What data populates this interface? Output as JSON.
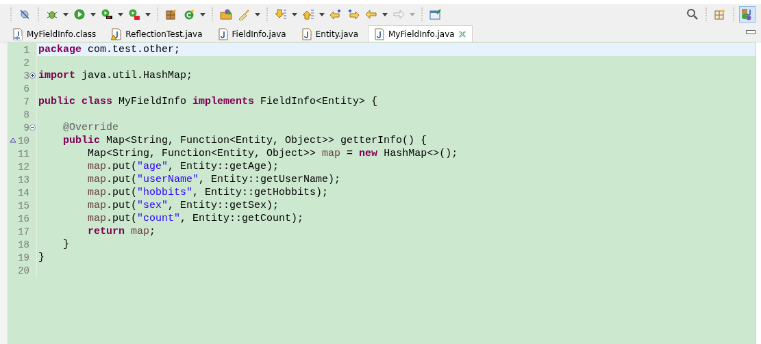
{
  "toolbar": {
    "items": [
      {
        "kind": "separator"
      },
      {
        "kind": "skip"
      },
      {
        "kind": "separator"
      },
      {
        "kind": "debug",
        "dropdown": true
      },
      {
        "kind": "run",
        "dropdown": true
      },
      {
        "kind": "coverage",
        "dropdown": true
      },
      {
        "kind": "external",
        "dropdown": true
      },
      {
        "kind": "separator"
      },
      {
        "kind": "new-package"
      },
      {
        "kind": "new-class",
        "dropdown": true
      },
      {
        "kind": "separator"
      },
      {
        "kind": "open-type"
      },
      {
        "kind": "open-task",
        "dropdown": true
      },
      {
        "kind": "separator"
      },
      {
        "kind": "next",
        "dropdown": true
      },
      {
        "kind": "prev",
        "dropdown": true
      },
      {
        "kind": "edit-back"
      },
      {
        "kind": "edit-forward"
      },
      {
        "kind": "back",
        "dropdown": true
      },
      {
        "kind": "forward",
        "dropdown": true,
        "disabled": true
      },
      {
        "kind": "separator"
      },
      {
        "kind": "pin"
      }
    ],
    "right": [
      {
        "kind": "search"
      },
      {
        "kind": "separator"
      },
      {
        "kind": "open-perspective"
      },
      {
        "kind": "separator"
      },
      {
        "kind": "java-perspective",
        "selected": true
      }
    ]
  },
  "tabs": [
    {
      "label": "MyFieldInfo.class",
      "kind": "class",
      "warning": false,
      "selected": false
    },
    {
      "label": "ReflectionTest.java",
      "kind": "java",
      "warning": true,
      "selected": false
    },
    {
      "label": "FieldInfo.java",
      "kind": "java",
      "warning": false,
      "selected": false
    },
    {
      "label": "Entity.java",
      "kind": "java",
      "warning": false,
      "selected": false
    },
    {
      "label": "MyFieldInfo.java",
      "kind": "java",
      "warning": false,
      "selected": true
    }
  ],
  "editor": {
    "lines": [
      {
        "number": "1",
        "current": true,
        "tokens": [
          {
            "kind": "keyword",
            "text": "package"
          },
          {
            "kind": "plain",
            "text": " com.test.other;"
          }
        ]
      },
      {
        "number": "2",
        "current": false
      },
      {
        "number": "3",
        "current": false,
        "collapsed": true,
        "tokens": [
          {
            "kind": "keyword",
            "text": "import"
          },
          {
            "kind": "plain",
            "text": " java.util.HashMap;"
          }
        ]
      },
      {
        "number": "6",
        "current": false
      },
      {
        "number": "7",
        "current": false,
        "tokens": [
          {
            "kind": "keyword",
            "text": "public"
          },
          {
            "kind": "keyword",
            "text": " class"
          },
          {
            "kind": "plain",
            "text": " MyFieldInfo "
          },
          {
            "kind": "keyword",
            "text": "implements"
          },
          {
            "kind": "plain",
            "text": " FieldInfo<Entity> {"
          }
        ]
      },
      {
        "number": "8",
        "current": false
      },
      {
        "number": "9",
        "current": false,
        "collapsed": false,
        "tokens": [
          {
            "kind": "annotation",
            "text": "    @Override"
          }
        ]
      },
      {
        "number": "10",
        "current": false,
        "override": true,
        "tokens": [
          {
            "kind": "keyword",
            "text": "    public"
          },
          {
            "kind": "plain",
            "text": " Map<String, Function<Entity, Object>> getterInfo() {"
          }
        ]
      },
      {
        "number": "11",
        "current": false,
        "tokens": [
          {
            "kind": "plain",
            "text": "        Map<String, Function<Entity, Object>> "
          },
          {
            "kind": "variable",
            "text": "map"
          },
          {
            "kind": "plain",
            "text": " = "
          },
          {
            "kind": "keyword",
            "text": "new"
          },
          {
            "kind": "plain",
            "text": " HashMap<>();"
          }
        ]
      },
      {
        "number": "12",
        "current": false,
        "tokens": [
          {
            "kind": "variable",
            "text": "        map"
          },
          {
            "kind": "plain",
            "text": ".put("
          },
          {
            "kind": "string",
            "text": "\"age\""
          },
          {
            "kind": "plain",
            "text": ", Entity::getAge);"
          }
        ]
      },
      {
        "number": "13",
        "current": false,
        "tokens": [
          {
            "kind": "variable",
            "text": "        map"
          },
          {
            "kind": "plain",
            "text": ".put("
          },
          {
            "kind": "string",
            "text": "\"userName\""
          },
          {
            "kind": "plain",
            "text": ", Entity::getUserName);"
          }
        ]
      },
      {
        "number": "14",
        "current": false,
        "tokens": [
          {
            "kind": "variable",
            "text": "        map"
          },
          {
            "kind": "plain",
            "text": ".put("
          },
          {
            "kind": "string",
            "text": "\"hobbits\""
          },
          {
            "kind": "plain",
            "text": ", Entity::getHobbits);"
          }
        ]
      },
      {
        "number": "15",
        "current": false,
        "tokens": [
          {
            "kind": "variable",
            "text": "        map"
          },
          {
            "kind": "plain",
            "text": ".put("
          },
          {
            "kind": "string",
            "text": "\"sex\""
          },
          {
            "kind": "plain",
            "text": ", Entity::getSex);"
          }
        ]
      },
      {
        "number": "16",
        "current": false,
        "tokens": [
          {
            "kind": "variable",
            "text": "        map"
          },
          {
            "kind": "plain",
            "text": ".put("
          },
          {
            "kind": "string",
            "text": "\"count\""
          },
          {
            "kind": "plain",
            "text": ", Entity::getCount);"
          }
        ]
      },
      {
        "number": "17",
        "current": false,
        "tokens": [
          {
            "kind": "keyword",
            "text": "        return"
          },
          {
            "kind": "variable",
            "text": " map"
          },
          {
            "kind": "plain",
            "text": ";"
          }
        ]
      },
      {
        "number": "18",
        "current": false,
        "tokens": [
          {
            "kind": "plain",
            "text": "    }"
          }
        ]
      },
      {
        "number": "19",
        "current": false,
        "tokens": [
          {
            "kind": "plain",
            "text": "}"
          }
        ]
      },
      {
        "number": "20",
        "current": false
      }
    ]
  }
}
